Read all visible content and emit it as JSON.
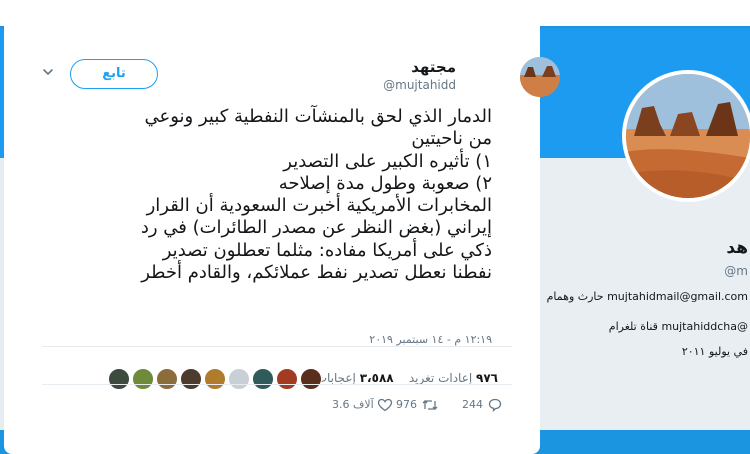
{
  "author": {
    "name": "مجتهد",
    "handle": "@mujtahidd",
    "follow_label": "تابع"
  },
  "tweet": {
    "lines": [
      "الدمار الذي لحق بالمنشآت النفطية كبير ونوعي",
      "من ناحيتين",
      "١) تأثيره الكبير على التصدير",
      "٢) صعوبة وطول مدة إصلاحه",
      "المخابرات الأمريكية أخبرت السعودية أن القرار",
      "إيراني (بغض النظر عن مصدر الطائرات) في رد",
      "ذكي على أمريكا مفاده: مثلما تعطلون تصدير",
      "نفطنا نعطل تصدير نفط عملائكم، والقادم أخطر"
    ],
    "timestamp": "١٢:١٩ م - ١٤ سبتمبر ٢٠١٩"
  },
  "stats": {
    "retweets_count": "٩٧٦",
    "retweets_label": "إعادات تغريد",
    "likes_count": "٣،٥٨٨",
    "likes_label": "إعجابات"
  },
  "actions": {
    "replies": "244",
    "retweets": "976",
    "likes": "3.6 آلاف"
  },
  "background_profile": {
    "name": "هد",
    "handle": "@m",
    "email_line": "mujtahidmail@gmail.com حارث وهمام",
    "telegram_line": "@mujtahiddcha قناة تلغرام",
    "joined_line": "في يوليو ٢٠١١"
  },
  "colors": {
    "accent": "#1da1f2",
    "header_blue": "#1d9bf0",
    "text": "#14171a",
    "muted": "#657786"
  }
}
